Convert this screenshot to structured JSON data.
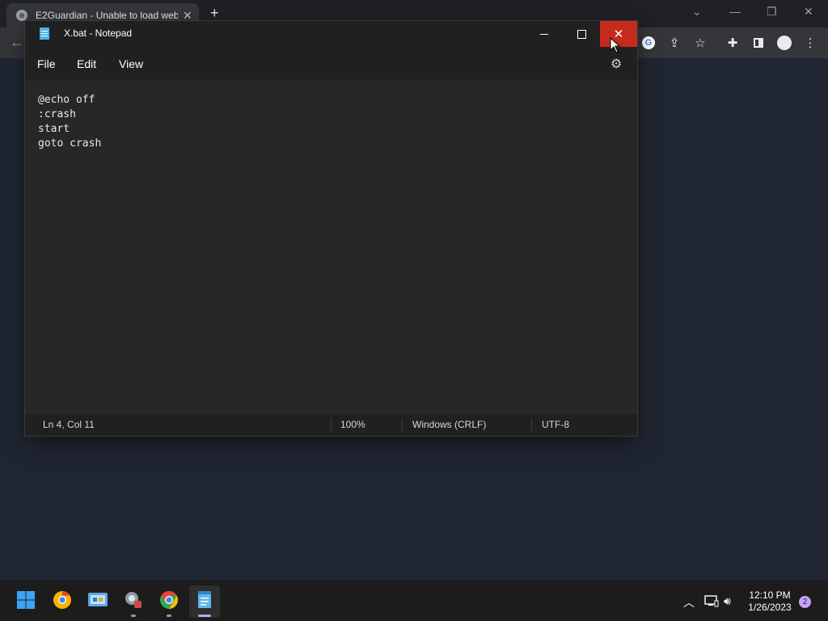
{
  "browser": {
    "tab_title": "E2Guardian - Unable to load web",
    "tab_close": "✕",
    "new_tab": "+",
    "google_icon_letter": "G"
  },
  "notepad": {
    "window_title": "X.bat - Notepad",
    "menu": {
      "file": "File",
      "edit": "Edit",
      "view": "View"
    },
    "lines": [
      "@echo off",
      ":crash",
      "start",
      "goto crash"
    ],
    "status": {
      "position": "Ln 4, Col 11",
      "zoom": "100%",
      "line_ending": "Windows (CRLF)",
      "encoding": "UTF-8"
    }
  },
  "taskbar": {
    "time": "12:10 PM",
    "date": "1/26/2023",
    "notification_count": "2"
  },
  "colors": {
    "close_hover": "#c42b1c",
    "accent": "#c8a2ff",
    "notepad_bg": "#272727"
  }
}
